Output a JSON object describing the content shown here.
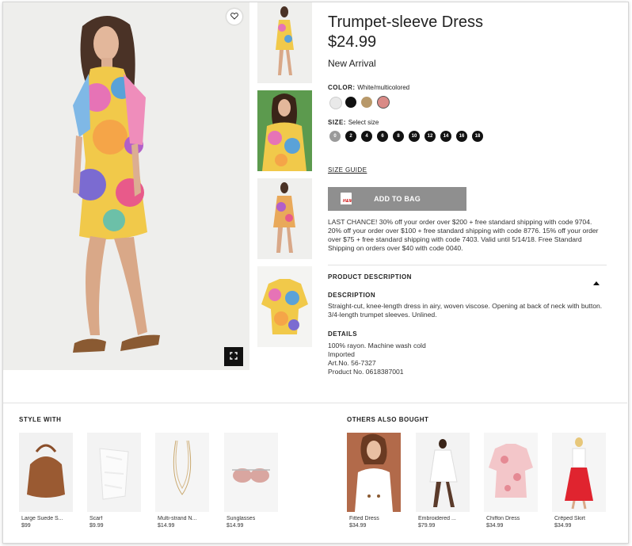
{
  "product": {
    "title": "Trumpet-sleeve Dress",
    "price": "$24.99",
    "badge": "New Arrival",
    "color_label": "COLOR:",
    "color_value": "White/multicolored",
    "size_label": "SIZE:",
    "size_hint": "Select size",
    "sizes": [
      "0",
      "2",
      "4",
      "6",
      "8",
      "10",
      "12",
      "14",
      "16",
      "18"
    ],
    "size_guide": "SIZE GUIDE",
    "add_to_bag": "ADD TO BAG",
    "promo": "LAST CHANCE! 30% off your order over $200 + free standard shipping with code 9704. 20% off your order over $100 + free standard shipping with code 8776. 15% off your order over $75 + free standard shipping with code 7403. Valid until 5/14/18. Free Standard Shipping on orders over $40 with code 0040."
  },
  "swatch_colors": [
    "#e9e9e9",
    "#111111",
    "#b8996a",
    "#d98a86"
  ],
  "details": {
    "section_title": "PRODUCT DESCRIPTION",
    "description_title": "DESCRIPTION",
    "description": "Straight-cut, knee-length dress in airy, woven viscose. Opening at back of neck with button. 3/4-length trumpet sleeves. Unlined.",
    "details_title": "DETAILS",
    "lines": [
      "100% rayon. Machine wash cold",
      "Imported",
      "Art.No. 56-7327",
      "Product No. 0618387001"
    ]
  },
  "style_with": {
    "title": "STYLE WITH",
    "items": [
      {
        "name": "Large Suede S...",
        "price": "$99"
      },
      {
        "name": "Scarf",
        "price": "$9.99"
      },
      {
        "name": "Multi-strand N...",
        "price": "$14.99"
      },
      {
        "name": "Sunglasses",
        "price": "$14.99"
      }
    ]
  },
  "others": {
    "title": "OTHERS ALSO BOUGHT",
    "items": [
      {
        "name": "Fitted Dress",
        "price": "$34.99"
      },
      {
        "name": "Embroidered ...",
        "price": "$79.99"
      },
      {
        "name": "Chiffon Dress",
        "price": "$34.99"
      },
      {
        "name": "Crêped Skirt",
        "price": "$34.99"
      }
    ]
  },
  "icons": {
    "favorite": "heart-icon",
    "expand": "expand-icon",
    "collapse": "caret-up-icon",
    "bag": "shopping-bag-icon"
  }
}
